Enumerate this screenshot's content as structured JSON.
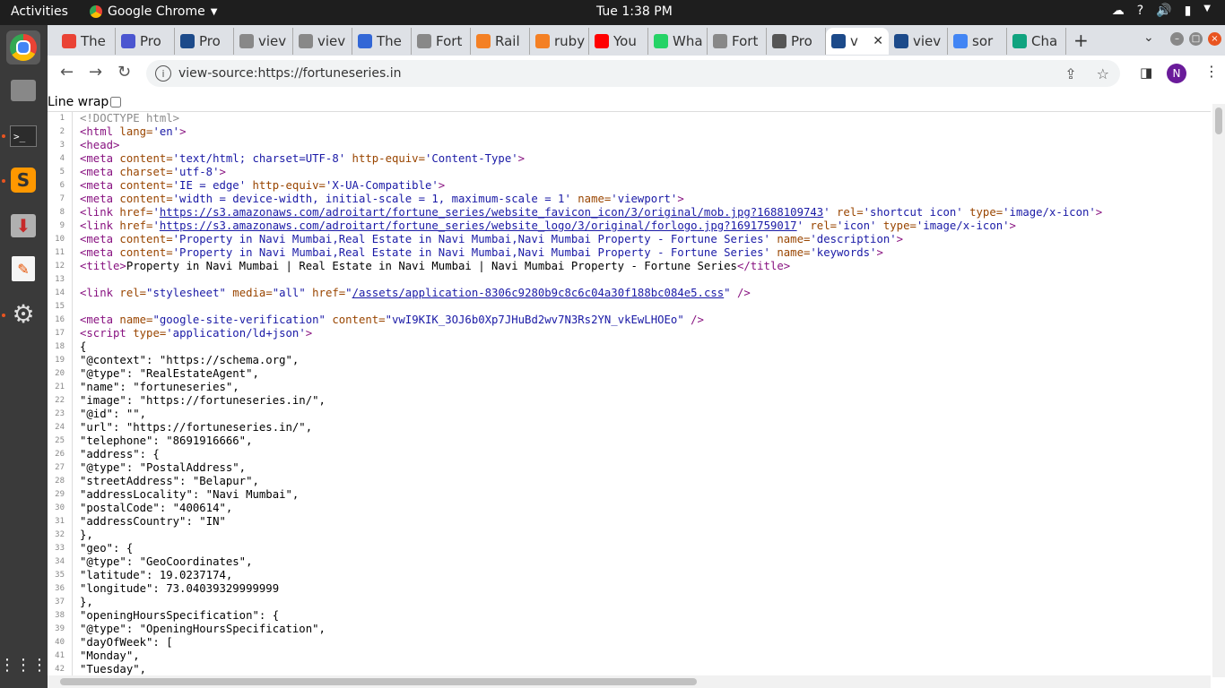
{
  "os": {
    "activities": "Activities",
    "app_name": "Google Chrome",
    "clock": "Tue  1:38 PM"
  },
  "tabs": [
    {
      "label": "The",
      "color": "#ea4335",
      "icon": "gmail-icon"
    },
    {
      "label": "Pro",
      "color": "#4a55d0",
      "icon": "document-icon"
    },
    {
      "label": "Pro",
      "color": "#1c4a8a",
      "icon": "fortune-icon"
    },
    {
      "label": "viev",
      "color": "#888888",
      "icon": "globe-icon"
    },
    {
      "label": "viev",
      "color": "#888888",
      "icon": "globe-icon"
    },
    {
      "label": "The",
      "color": "#3367d6",
      "icon": "docs-icon"
    },
    {
      "label": "Fort",
      "color": "#888888",
      "icon": "globe-icon"
    },
    {
      "label": "Rail",
      "color": "#f48024",
      "icon": "stackoverflow-icon"
    },
    {
      "label": "ruby",
      "color": "#f48024",
      "icon": "stackoverflow-icon"
    },
    {
      "label": "You",
      "color": "#ff0000",
      "icon": "youtube-icon"
    },
    {
      "label": "Wha",
      "color": "#25d366",
      "icon": "whatsapp-icon"
    },
    {
      "label": "Fort",
      "color": "#888888",
      "icon": "globe-icon"
    },
    {
      "label": "Pro",
      "color": "#555555",
      "icon": "globe-icon"
    },
    {
      "label": "v",
      "color": "#1c4a8a",
      "icon": "fortune-icon",
      "active": true
    },
    {
      "label": "viev",
      "color": "#1c4a8a",
      "icon": "fortune-icon"
    },
    {
      "label": "sor",
      "color": "#4285f4",
      "icon": "google-icon"
    },
    {
      "label": "Cha",
      "color": "#10a37f",
      "icon": "chatgpt-icon"
    }
  ],
  "toolbar": {
    "url": "view-source:https://fortuneseries.in",
    "avatar_letter": "N"
  },
  "page": {
    "line_wrap_label": "Line wrap"
  },
  "source_lines": [
    [
      [
        "cmt",
        "<!DOCTYPE html>"
      ]
    ],
    [
      [
        "tag",
        "<html "
      ],
      [
        "attr",
        "lang="
      ],
      [
        "val",
        "'en'"
      ],
      [
        "tag",
        ">"
      ]
    ],
    [
      [
        "tag",
        "<head>"
      ]
    ],
    [
      [
        "tag",
        "<meta "
      ],
      [
        "attr",
        "content="
      ],
      [
        "val",
        "'text/html; charset=UTF-8' "
      ],
      [
        "attr",
        "http-equiv="
      ],
      [
        "val",
        "'Content-Type'"
      ],
      [
        "tag",
        ">"
      ]
    ],
    [
      [
        "tag",
        "<meta "
      ],
      [
        "attr",
        "charset="
      ],
      [
        "val",
        "'utf-8'"
      ],
      [
        "tag",
        ">"
      ]
    ],
    [
      [
        "tag",
        "<meta "
      ],
      [
        "attr",
        "content="
      ],
      [
        "val",
        "'IE = edge' "
      ],
      [
        "attr",
        "http-equiv="
      ],
      [
        "val",
        "'X-UA-Compatible'"
      ],
      [
        "tag",
        ">"
      ]
    ],
    [
      [
        "tag",
        "<meta "
      ],
      [
        "attr",
        "content="
      ],
      [
        "val",
        "'width = device-width, initial-scale = 1, maximum-scale = 1' "
      ],
      [
        "attr",
        "name="
      ],
      [
        "val",
        "'viewport'"
      ],
      [
        "tag",
        ">"
      ]
    ],
    [
      [
        "tag",
        "<link "
      ],
      [
        "attr",
        "href="
      ],
      [
        "val",
        "'"
      ],
      [
        "lnk",
        "https://s3.amazonaws.com/adroitart/fortune_series/website_favicon_icon/3/original/mob.jpg?1688109743"
      ],
      [
        "val",
        "' "
      ],
      [
        "attr",
        "rel="
      ],
      [
        "val",
        "'shortcut icon' "
      ],
      [
        "attr",
        "type="
      ],
      [
        "val",
        "'image/x-icon'"
      ],
      [
        "tag",
        ">"
      ]
    ],
    [
      [
        "tag",
        "<link "
      ],
      [
        "attr",
        "href="
      ],
      [
        "val",
        "'"
      ],
      [
        "lnk",
        "https://s3.amazonaws.com/adroitart/fortune_series/website_logo/3/original/forlogo.jpg?1691759017"
      ],
      [
        "val",
        "' "
      ],
      [
        "attr",
        "rel="
      ],
      [
        "val",
        "'icon' "
      ],
      [
        "attr",
        "type="
      ],
      [
        "val",
        "'image/x-icon'"
      ],
      [
        "tag",
        ">"
      ]
    ],
    [
      [
        "tag",
        "<meta "
      ],
      [
        "attr",
        "content="
      ],
      [
        "val",
        "'Property in Navi Mumbai,Real Estate in Navi Mumbai,Navi Mumbai Property - Fortune Series' "
      ],
      [
        "attr",
        "name="
      ],
      [
        "val",
        "'description'"
      ],
      [
        "tag",
        ">"
      ]
    ],
    [
      [
        "tag",
        "<meta "
      ],
      [
        "attr",
        "content="
      ],
      [
        "val",
        "'Property in Navi Mumbai,Real Estate in Navi Mumbai,Navi Mumbai Property - Fortune Series' "
      ],
      [
        "attr",
        "name="
      ],
      [
        "val",
        "'keywords'"
      ],
      [
        "tag",
        ">"
      ]
    ],
    [
      [
        "tag",
        "<title>"
      ],
      [
        "txt",
        "Property in Navi Mumbai | Real Estate in Navi Mumbai | Navi Mumbai Property - Fortune Series"
      ],
      [
        "tag",
        "</title>"
      ]
    ],
    [],
    [
      [
        "tag",
        "<link "
      ],
      [
        "attr",
        "rel="
      ],
      [
        "val",
        "\"stylesheet\" "
      ],
      [
        "attr",
        "media="
      ],
      [
        "val",
        "\"all\" "
      ],
      [
        "attr",
        "href="
      ],
      [
        "val",
        "\""
      ],
      [
        "lnk",
        "/assets/application-8306c9280b9c8c6c04a30f188bc084e5.css"
      ],
      [
        "val",
        "\" "
      ],
      [
        "tag",
        "/>"
      ]
    ],
    [],
    [
      [
        "tag",
        "<meta "
      ],
      [
        "attr",
        "name="
      ],
      [
        "val",
        "\"google-site-verification\" "
      ],
      [
        "attr",
        "content="
      ],
      [
        "val",
        "\"vwI9KIK_3OJ6b0Xp7JHuBd2wv7N3Rs2YN_vkEwLHOEo\" "
      ],
      [
        "tag",
        "/>"
      ]
    ],
    [
      [
        "tag",
        "<script "
      ],
      [
        "attr",
        "type="
      ],
      [
        "val",
        "'application/ld+json'"
      ],
      [
        "tag",
        ">"
      ]
    ],
    [
      [
        "txt",
        "{"
      ]
    ],
    [
      [
        "txt",
        "\"@context\": \"https://schema.org\","
      ]
    ],
    [
      [
        "txt",
        "\"@type\": \"RealEstateAgent\","
      ]
    ],
    [
      [
        "txt",
        "\"name\": \"fortuneseries\","
      ]
    ],
    [
      [
        "txt",
        "\"image\": \"https://fortuneseries.in/\","
      ]
    ],
    [
      [
        "txt",
        "\"@id\": \"\","
      ]
    ],
    [
      [
        "txt",
        "\"url\": \"https://fortuneseries.in/\","
      ]
    ],
    [
      [
        "txt",
        "\"telephone\": \"8691916666\","
      ]
    ],
    [
      [
        "txt",
        "\"address\": {"
      ]
    ],
    [
      [
        "txt",
        "\"@type\": \"PostalAddress\","
      ]
    ],
    [
      [
        "txt",
        "\"streetAddress\": \"Belapur\","
      ]
    ],
    [
      [
        "txt",
        "\"addressLocality\": \"Navi Mumbai\","
      ]
    ],
    [
      [
        "txt",
        "\"postalCode\": \"400614\","
      ]
    ],
    [
      [
        "txt",
        "\"addressCountry\": \"IN\""
      ]
    ],
    [
      [
        "txt",
        "},"
      ]
    ],
    [
      [
        "txt",
        "\"geo\": {"
      ]
    ],
    [
      [
        "txt",
        "\"@type\": \"GeoCoordinates\","
      ]
    ],
    [
      [
        "txt",
        "\"latitude\": 19.0237174,"
      ]
    ],
    [
      [
        "txt",
        "\"longitude\": 73.04039329999999"
      ]
    ],
    [
      [
        "txt",
        "},"
      ]
    ],
    [
      [
        "txt",
        "\"openingHoursSpecification\": {"
      ]
    ],
    [
      [
        "txt",
        "\"@type\": \"OpeningHoursSpecification\","
      ]
    ],
    [
      [
        "txt",
        "\"dayOfWeek\": ["
      ]
    ],
    [
      [
        "txt",
        "\"Monday\","
      ]
    ],
    [
      [
        "txt",
        "\"Tuesday\","
      ]
    ]
  ]
}
